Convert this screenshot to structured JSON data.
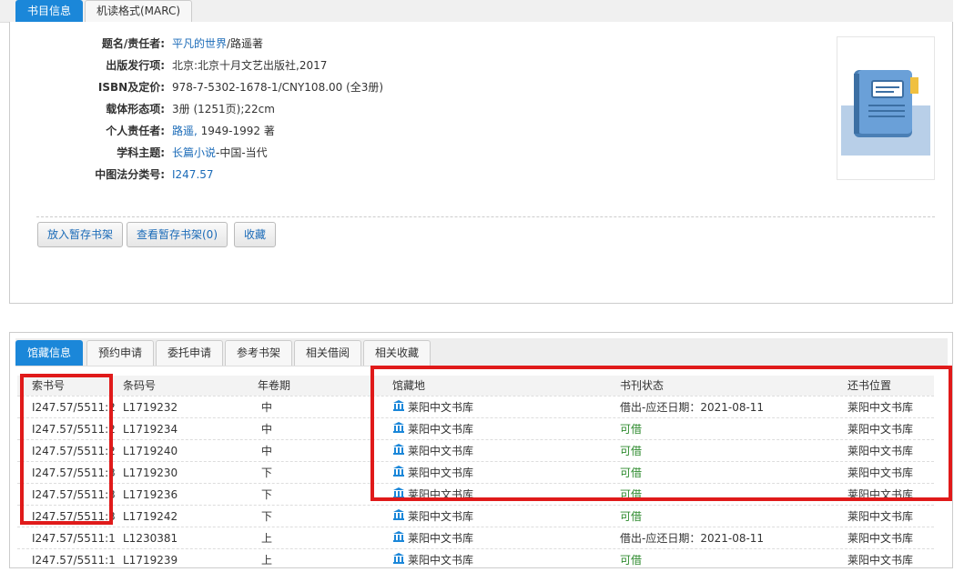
{
  "top_tabs": [
    "书目信息",
    "机读格式(MARC)"
  ],
  "fields": [
    {
      "label": "题名/责任者:",
      "parts": [
        {
          "text": "平凡的世界",
          "link": true
        },
        {
          "text": "/路遥著",
          "link": false
        }
      ]
    },
    {
      "label": "出版发行项:",
      "parts": [
        {
          "text": "北京:北京十月文艺出版社,2017",
          "link": false
        }
      ]
    },
    {
      "label": "ISBN及定价:",
      "parts": [
        {
          "text": "978-7-5302-1678-1/CNY108.00 (全3册)",
          "link": false
        }
      ]
    },
    {
      "label": "载体形态项:",
      "parts": [
        {
          "text": "3册 (1251页);22cm",
          "link": false
        }
      ]
    },
    {
      "label": "个人责任者:",
      "parts": [
        {
          "text": "路遥,",
          "link": true
        },
        {
          "text": " 1949-1992 著",
          "link": false
        }
      ]
    },
    {
      "label": "学科主题:",
      "parts": [
        {
          "text": "长篇小说",
          "link": true
        },
        {
          "text": "-中国-当代",
          "link": false
        }
      ]
    },
    {
      "label": "中图法分类号:",
      "parts": [
        {
          "text": "I247.57",
          "link": true
        }
      ]
    }
  ],
  "buttons": [
    "放入暂存书架",
    "查看暂存书架(0)",
    "收藏"
  ],
  "hold_tabs": [
    "馆藏信息",
    "预约申请",
    "委托申请",
    "参考书架",
    "相关借阅",
    "相关收藏"
  ],
  "columns": [
    "索书号",
    "条码号",
    "年卷期",
    "馆藏地",
    "书刊状态",
    "还书位置"
  ],
  "rows": [
    {
      "callno": "I247.57/5511:2",
      "barcode": "L1719232",
      "vol": "中",
      "location": "莱阳中文书库",
      "status": "借出-应还日期：2021-08-11",
      "available": false,
      "return_loc": "莱阳中文书库"
    },
    {
      "callno": "I247.57/5511:2",
      "barcode": "L1719234",
      "vol": "中",
      "location": "莱阳中文书库",
      "status": "可借",
      "available": true,
      "return_loc": "莱阳中文书库"
    },
    {
      "callno": "I247.57/5511:2",
      "barcode": "L1719240",
      "vol": "中",
      "location": "莱阳中文书库",
      "status": "可借",
      "available": true,
      "return_loc": "莱阳中文书库"
    },
    {
      "callno": "I247.57/5511:3",
      "barcode": "L1719230",
      "vol": "下",
      "location": "莱阳中文书库",
      "status": "可借",
      "available": true,
      "return_loc": "莱阳中文书库"
    },
    {
      "callno": "I247.57/5511:3",
      "barcode": "L1719236",
      "vol": "下",
      "location": "莱阳中文书库",
      "status": "可借",
      "available": true,
      "return_loc": "莱阳中文书库"
    },
    {
      "callno": "I247.57/5511:3",
      "barcode": "L1719242",
      "vol": "下",
      "location": "莱阳中文书库",
      "status": "可借",
      "available": true,
      "return_loc": "莱阳中文书库"
    },
    {
      "callno": "I247.57/5511:1",
      "barcode": "L1230381",
      "vol": "上",
      "location": "莱阳中文书库",
      "status": "借出-应还日期：2021-08-11",
      "available": false,
      "return_loc": "莱阳中文书库"
    },
    {
      "callno": "I247.57/5511:1",
      "barcode": "L1719239",
      "vol": "上",
      "location": "莱阳中文书库",
      "status": "可借",
      "available": true,
      "return_loc": "莱阳中文书库"
    }
  ],
  "colors": {
    "accent": "#1b87d9",
    "link": "#1b6bb8",
    "available": "#2e8b2e",
    "highlight": "#e01a1a"
  },
  "icons": {
    "cover": "notebook-icon",
    "location": "library-building-icon"
  }
}
